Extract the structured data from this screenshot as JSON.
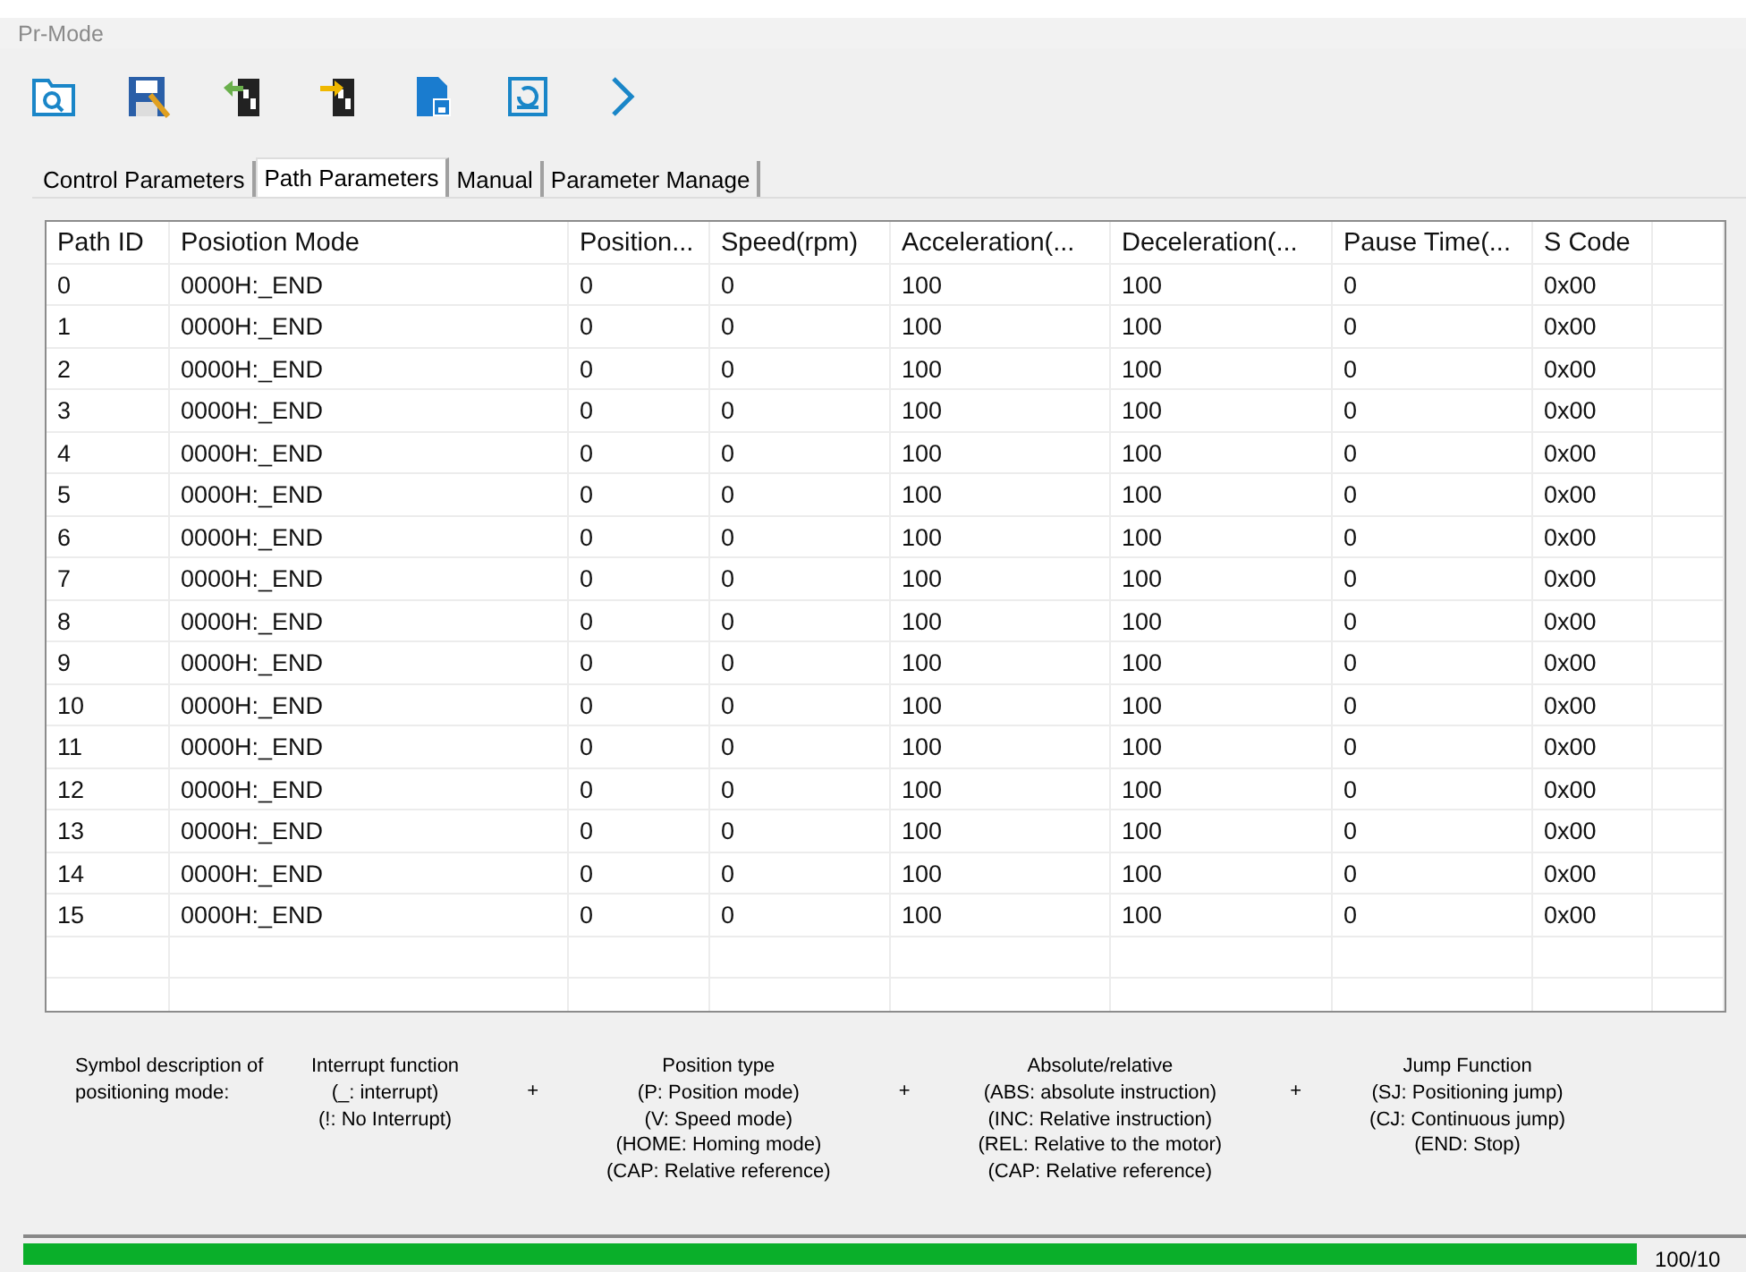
{
  "window": {
    "title": "Pr-Mode"
  },
  "toolbar": [
    {
      "kind": "open"
    },
    {
      "kind": "save"
    },
    {
      "kind": "upload"
    },
    {
      "kind": "download"
    },
    {
      "kind": "export"
    },
    {
      "kind": "restore"
    },
    {
      "kind": "next"
    }
  ],
  "tabs": [
    {
      "label": "Control Parameters",
      "selected": false
    },
    {
      "label": "Path Parameters",
      "selected": true
    },
    {
      "label": "Manual",
      "selected": false
    },
    {
      "label": "Parameter Manage",
      "selected": false
    }
  ],
  "table": {
    "columns": [
      "Path ID",
      "Posiotion Mode",
      "Position...",
      "Speed(rpm)",
      "Acceleration(...",
      "Deceleration(...",
      "Pause Time(...",
      "S Code"
    ],
    "rows": [
      [
        "0",
        "0000H:_END",
        "0",
        "0",
        "100",
        "100",
        "0",
        "0x00"
      ],
      [
        "1",
        "0000H:_END",
        "0",
        "0",
        "100",
        "100",
        "0",
        "0x00"
      ],
      [
        "2",
        "0000H:_END",
        "0",
        "0",
        "100",
        "100",
        "0",
        "0x00"
      ],
      [
        "3",
        "0000H:_END",
        "0",
        "0",
        "100",
        "100",
        "0",
        "0x00"
      ],
      [
        "4",
        "0000H:_END",
        "0",
        "0",
        "100",
        "100",
        "0",
        "0x00"
      ],
      [
        "5",
        "0000H:_END",
        "0",
        "0",
        "100",
        "100",
        "0",
        "0x00"
      ],
      [
        "6",
        "0000H:_END",
        "0",
        "0",
        "100",
        "100",
        "0",
        "0x00"
      ],
      [
        "7",
        "0000H:_END",
        "0",
        "0",
        "100",
        "100",
        "0",
        "0x00"
      ],
      [
        "8",
        "0000H:_END",
        "0",
        "0",
        "100",
        "100",
        "0",
        "0x00"
      ],
      [
        "9",
        "0000H:_END",
        "0",
        "0",
        "100",
        "100",
        "0",
        "0x00"
      ],
      [
        "10",
        "0000H:_END",
        "0",
        "0",
        "100",
        "100",
        "0",
        "0x00"
      ],
      [
        "11",
        "0000H:_END",
        "0",
        "0",
        "100",
        "100",
        "0",
        "0x00"
      ],
      [
        "12",
        "0000H:_END",
        "0",
        "0",
        "100",
        "100",
        "0",
        "0x00"
      ],
      [
        "13",
        "0000H:_END",
        "0",
        "0",
        "100",
        "100",
        "0",
        "0x00"
      ],
      [
        "14",
        "0000H:_END",
        "0",
        "0",
        "100",
        "100",
        "0",
        "0x00"
      ],
      [
        "15",
        "0000H:_END",
        "0",
        "0",
        "100",
        "100",
        "0",
        "0x00"
      ]
    ]
  },
  "legend": {
    "intro": "Symbol description of positioning mode:",
    "groups": [
      {
        "title": "Interrupt function",
        "lines": [
          "(_: interrupt)",
          "(!: No Interrupt)"
        ]
      },
      {
        "title": "Position type",
        "lines": [
          "(P: Position mode)",
          "(V: Speed mode)",
          "(HOME: Homing mode)",
          "(CAP: Relative reference)"
        ]
      },
      {
        "title": "Absolute/relative",
        "lines": [
          "(ABS: absolute instruction)",
          "(INC: Relative instruction)",
          "(REL: Relative to the motor)",
          "(CAP: Relative reference)"
        ]
      },
      {
        "title": "Jump Function",
        "lines": [
          "(SJ: Positioning jump)",
          "(CJ: Continuous jump)",
          "(END: Stop)"
        ]
      }
    ],
    "joiner": "+"
  },
  "progress": {
    "level": 1,
    "reading": "100/10"
  }
}
